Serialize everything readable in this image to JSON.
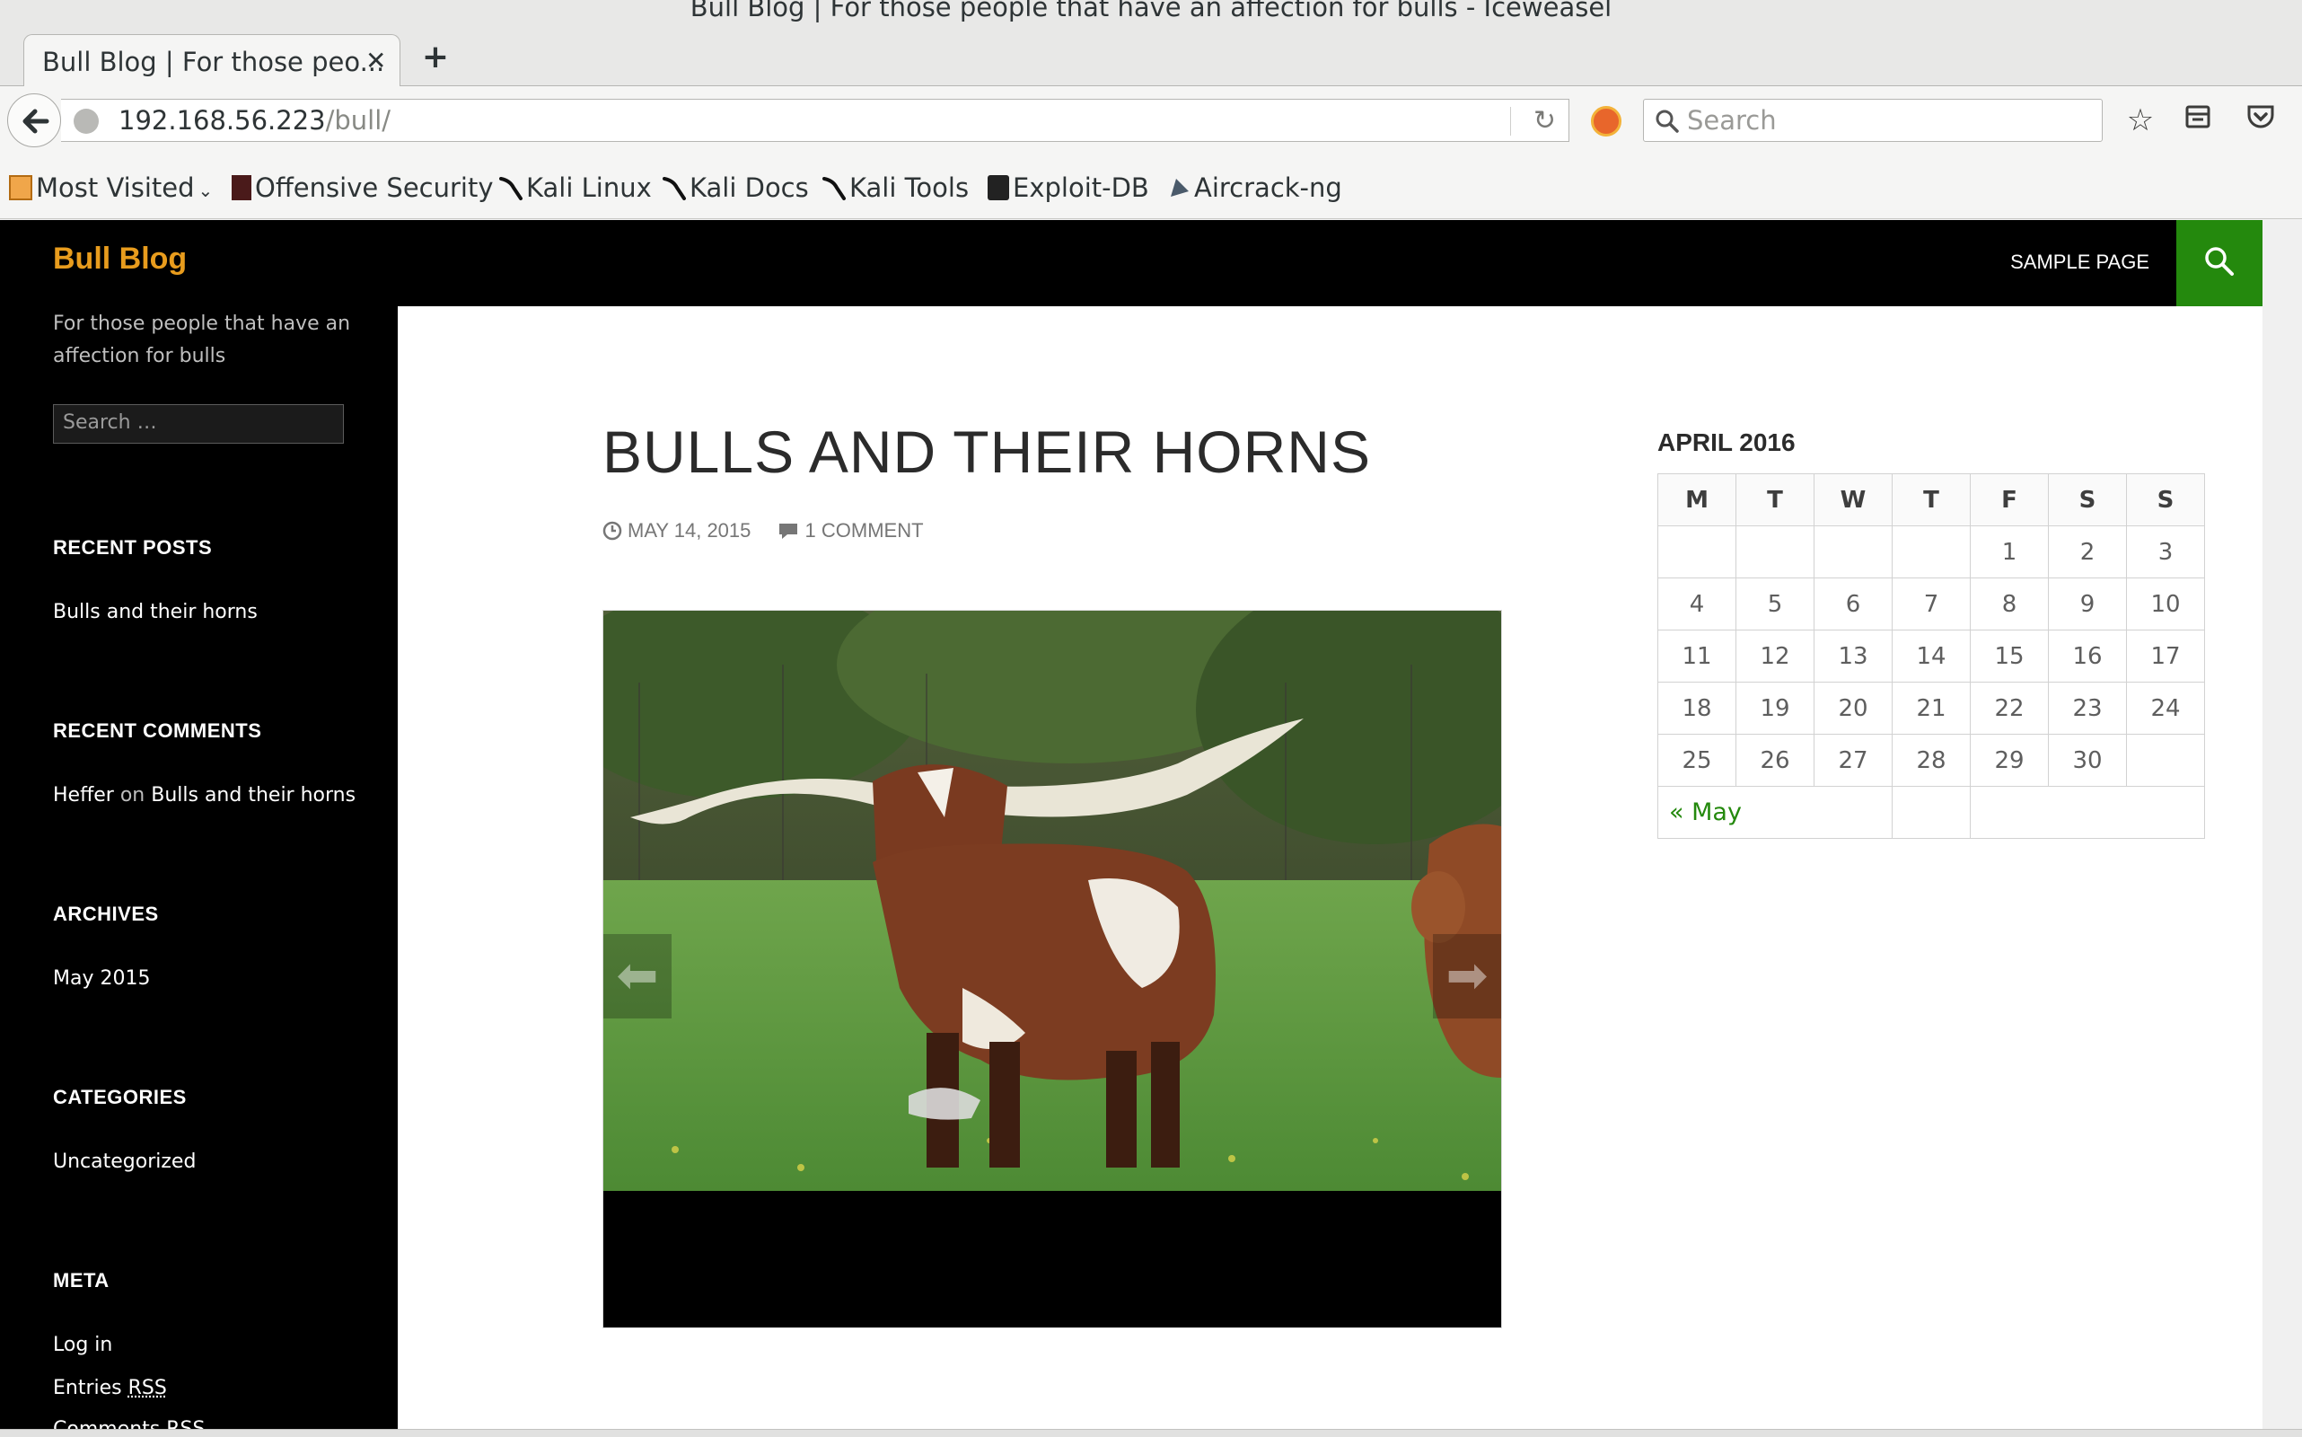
{
  "window": {
    "title": "Bull Blog | For those people that have an affection for bulls - Iceweasel"
  },
  "tab": {
    "label": "Bull Blog | For those peo...",
    "close": "✕",
    "new": "+"
  },
  "address_bar": {
    "host": "192.168.56.223",
    "path": "/bull/"
  },
  "search_bar": {
    "placeholder": "Search"
  },
  "bookmarks": [
    {
      "label": "Most Visited",
      "icon": "folder-icon"
    },
    {
      "label": "Offensive Security",
      "icon": "offsec-icon"
    },
    {
      "label": "Kali Linux",
      "icon": "kali-icon"
    },
    {
      "label": "Kali Docs",
      "icon": "kali-icon"
    },
    {
      "label": "Kali Tools",
      "icon": "kali-icon"
    },
    {
      "label": "Exploit-DB",
      "icon": "exploitdb-icon"
    },
    {
      "label": "Aircrack-ng",
      "icon": "aircrack-icon"
    }
  ],
  "site": {
    "title": "Bull Blog",
    "tagline": "For those people that have an affection for bulls",
    "search_placeholder": "Search …",
    "nav_link": "SAMPLE PAGE"
  },
  "sidebar": {
    "recent_posts": {
      "heading": "RECENT POSTS",
      "items": [
        "Bulls and their horns"
      ]
    },
    "recent_comments": {
      "heading": "RECENT COMMENTS",
      "author": "Heffer",
      "on": "on",
      "post": "Bulls and their horns"
    },
    "archives": {
      "heading": "ARCHIVES",
      "items": [
        "May 2015"
      ]
    },
    "categories": {
      "heading": "CATEGORIES",
      "items": [
        "Uncategorized"
      ]
    },
    "meta": {
      "heading": "META",
      "login": "Log in",
      "entries": "Entries",
      "rss": "RSS",
      "comments": "Comments"
    }
  },
  "post": {
    "title": "BULLS AND THEIR HORNS",
    "date": "MAY 14, 2015",
    "comments": "1 COMMENT"
  },
  "calendar": {
    "title": "APRIL 2016",
    "days": [
      "M",
      "T",
      "W",
      "T",
      "F",
      "S",
      "S"
    ],
    "weeks": [
      [
        "",
        "",
        "",
        "",
        "1",
        "2",
        "3"
      ],
      [
        "4",
        "5",
        "6",
        "7",
        "8",
        "9",
        "10"
      ],
      [
        "11",
        "12",
        "13",
        "14",
        "15",
        "16",
        "17"
      ],
      [
        "18",
        "19",
        "20",
        "21",
        "22",
        "23",
        "24"
      ],
      [
        "25",
        "26",
        "27",
        "28",
        "29",
        "30",
        ""
      ]
    ],
    "prev_link": "« May"
  },
  "colors": {
    "accent": "#24890d",
    "site_title": "#e89c1d",
    "sidebar_bg": "#000000"
  }
}
